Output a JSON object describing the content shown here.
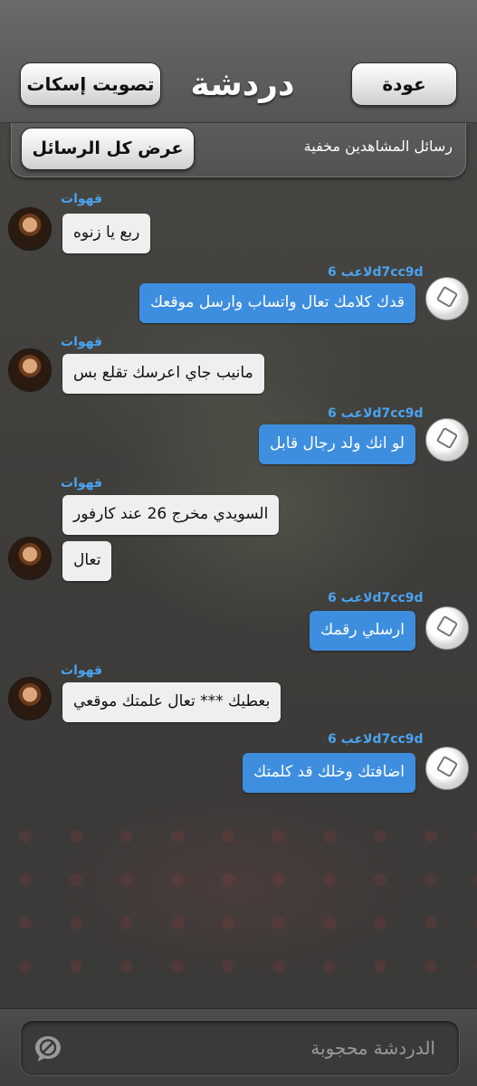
{
  "header": {
    "title": "دردشة",
    "mute_vote_label": "تصويت إسكات",
    "back_label": "عودة"
  },
  "notice": {
    "show_all_label": "عرض كل الرسائل",
    "hidden_text": "رسائل المشاهدين مخفية"
  },
  "messages": [
    {
      "sender": "قهوات",
      "text": "ربع يا زنوه",
      "side": "left"
    },
    {
      "sender": "لاعب 6d7cc9d",
      "text": "قدك كلامك تعال واتساب وارسل موقعك",
      "side": "right"
    },
    {
      "sender": "قهوات",
      "text": "مانيب جاي اعرسك تقلع بس",
      "side": "left"
    },
    {
      "sender": "لاعب 6d7cc9d",
      "text": "لو انك ولد رجال قابل",
      "side": "right"
    },
    {
      "sender": "قهوات",
      "text": "السويدي مخرج 26 عند كارفور",
      "side": "left"
    },
    {
      "sender": "",
      "text": "تعال",
      "side": "left"
    },
    {
      "sender": "لاعب 6d7cc9d",
      "text": "ارسلي رقمك",
      "side": "right"
    },
    {
      "sender": "قهوات",
      "text": "بعطيك *** تعال علمتك موقعي",
      "side": "left"
    },
    {
      "sender": "لاعب 6d7cc9d",
      "text": "اضافتك وخلك قد كلمتك",
      "side": "right"
    }
  ],
  "footer": {
    "input_placeholder": "الدردشة محجوبة",
    "icon": "chat-blocked-icon"
  },
  "colors": {
    "sender_name": "#4aa3f0",
    "own_bubble": "#3e8ee0",
    "other_bubble": "#efefef"
  }
}
